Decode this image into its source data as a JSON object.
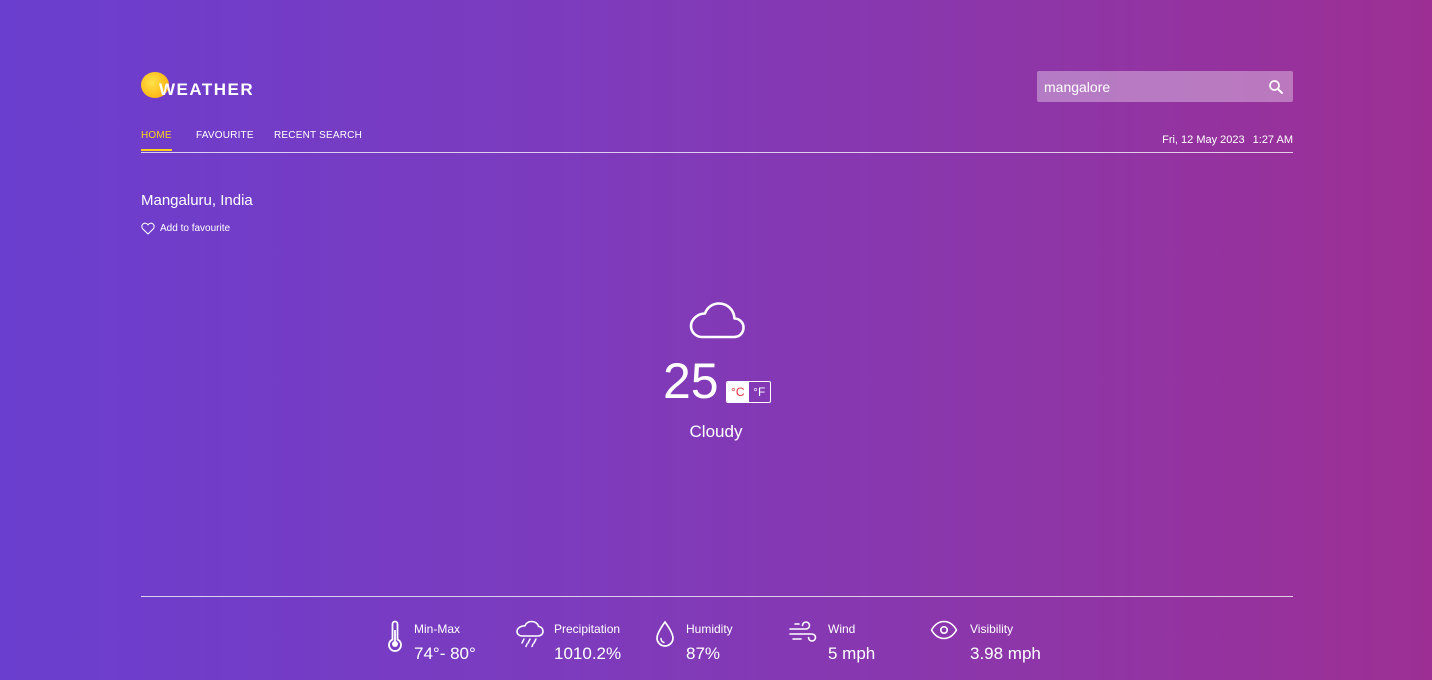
{
  "logo": {
    "text": "WEATHER"
  },
  "search": {
    "value": "mangalore",
    "icon": "search-icon"
  },
  "nav": {
    "tabs": [
      {
        "label": "HOME",
        "active": true
      },
      {
        "label": "FAVOURITE",
        "active": false
      },
      {
        "label": "RECENT SEARCH",
        "active": false
      }
    ]
  },
  "datetime": {
    "date": "Fri, 12 May 2023",
    "time": "1:27 AM"
  },
  "location": {
    "name": "Mangaluru, India",
    "favourite_label": "Add to favourite",
    "favourite_icon": "heart-icon"
  },
  "current": {
    "icon": "cloud-icon",
    "temperature": "25",
    "unit_c": "°C",
    "unit_f": "°F",
    "selected_unit": "°C",
    "condition": "Cloudy"
  },
  "stats": [
    {
      "label": "Min-Max",
      "value": "74°- 80°",
      "icon": "thermometer-icon"
    },
    {
      "label": "Precipitation",
      "value": "1010.2%",
      "icon": "rain-cloud-icon"
    },
    {
      "label": "Humidity",
      "value": "87%",
      "icon": "droplet-icon"
    },
    {
      "label": "Wind",
      "value": "5 mph",
      "icon": "wind-icon"
    },
    {
      "label": "Visibility",
      "value": "3.98 mph",
      "icon": "eye-icon"
    }
  ],
  "colors": {
    "accent": "#ffd21a",
    "unit_selected_text": "#e0303a",
    "bg_start": "#6a3ecf",
    "bg_end": "#9d2f94"
  }
}
